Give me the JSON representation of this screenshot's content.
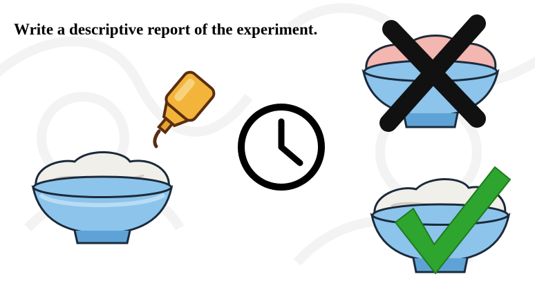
{
  "title": "Write a descriptive report of the experiment.",
  "icons": {
    "bottle": "yellow-squeeze-bottle-icon",
    "clock": "clock-icon",
    "bowl_left": "cream-bowl-icon",
    "bowl_pink": "pink-cream-bowl-icon",
    "cross": "black-x-icon",
    "bowl_right": "white-cream-bowl-icon",
    "check": "green-check-icon"
  },
  "colors": {
    "bowl_blue": "#8cc4ec",
    "bowl_blue_dark": "#5fa3d6",
    "cream": "#f1efe9",
    "cream_shadow": "#d8d5cd",
    "pink_cream": "#f4b6b0",
    "bottle_yellow": "#f2b43a",
    "bottle_dark": "#9a4a1c",
    "check_green": "#2ea52e",
    "cross_black": "#111111"
  }
}
